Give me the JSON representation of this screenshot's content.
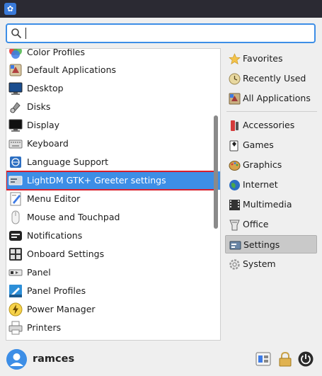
{
  "search": {
    "value": "",
    "placeholder": ""
  },
  "applications": [
    {
      "label": "Color Profiles",
      "icon": "color-profiles-icon"
    },
    {
      "label": "Default Applications",
      "icon": "default-applications-icon"
    },
    {
      "label": "Desktop",
      "icon": "desktop-icon"
    },
    {
      "label": "Disks",
      "icon": "disks-icon"
    },
    {
      "label": "Display",
      "icon": "display-icon"
    },
    {
      "label": "Keyboard",
      "icon": "keyboard-icon"
    },
    {
      "label": "Language Support",
      "icon": "language-support-icon"
    },
    {
      "label": "LightDM GTK+ Greeter settings",
      "icon": "lightdm-greeter-icon",
      "selected": true
    },
    {
      "label": "Menu Editor",
      "icon": "menu-editor-icon"
    },
    {
      "label": "Mouse and Touchpad",
      "icon": "mouse-icon"
    },
    {
      "label": "Notifications",
      "icon": "notifications-icon"
    },
    {
      "label": "Onboard Settings",
      "icon": "onboard-icon"
    },
    {
      "label": "Panel",
      "icon": "panel-icon"
    },
    {
      "label": "Panel Profiles",
      "icon": "panel-profiles-icon"
    },
    {
      "label": "Power Manager",
      "icon": "power-manager-icon"
    },
    {
      "label": "Printers",
      "icon": "printer-icon"
    }
  ],
  "categories": {
    "favorites": "Favorites",
    "recently_used": "Recently Used",
    "all_applications": "All Applications",
    "accessories": "Accessories",
    "games": "Games",
    "graphics": "Graphics",
    "internet": "Internet",
    "multimedia": "Multimedia",
    "office": "Office",
    "settings": "Settings",
    "system": "System"
  },
  "active_category": "Settings",
  "user": {
    "name": "ramces"
  },
  "colors": {
    "accent": "#3d8ee6",
    "highlight_border": "#d81e2b",
    "topbar": "#2b2a33"
  }
}
